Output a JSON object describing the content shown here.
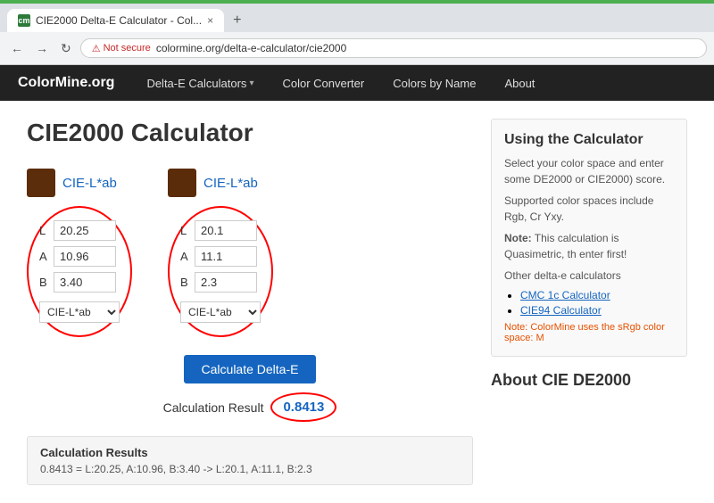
{
  "browser": {
    "tab_favicon": "cm",
    "tab_title": "CIE2000 Delta-E Calculator - Col...",
    "tab_close": "×",
    "new_tab": "+",
    "nav_back": "←",
    "nav_forward": "→",
    "nav_refresh": "↻",
    "not_secure_label": "Not secure",
    "url": "colormine.org/delta-e-calculator/cie2000"
  },
  "nav": {
    "logo": "ColorMine.org",
    "items": [
      {
        "label": "Delta-E Calculators",
        "has_dropdown": true
      },
      {
        "label": "Color Converter",
        "has_dropdown": false
      },
      {
        "label": "Colors by Name",
        "has_dropdown": false
      },
      {
        "label": "About",
        "has_dropdown": false
      }
    ]
  },
  "page": {
    "title": "CIE2000 Calculator"
  },
  "color1": {
    "swatch_color": "#5c2d0a",
    "space_label": "CIE-L*ab",
    "L_value": "20.25",
    "A_value": "10.96",
    "B_value": "3.40",
    "select_value": "CIE-L*ab"
  },
  "color2": {
    "swatch_color": "#5a2c0a",
    "space_label": "CIE-L*ab",
    "L_value": "20.1",
    "A_value": "11.1",
    "B_value": "2.3",
    "select_value": "CIE-L*ab"
  },
  "calculator": {
    "button_label": "Calculate Delta-E",
    "result_label": "Calculation Result",
    "result_value": "0.8413"
  },
  "calc_results_box": {
    "title": "Calculation Results",
    "text": "0.8413 = L:20.25, A:10.96, B:3.40 -> L:20.1, A:11.1, B:2.3"
  },
  "sidebar": {
    "using_title": "Using the Calculator",
    "using_text1": "Select your color space and enter some DE2000 or CIE2000) score.",
    "using_text2": "Supported color spaces include Rgb, Cr Yxy.",
    "note_label": "Note:",
    "note_text": "This calculation is Quasimetric, th enter first!",
    "other_calcs_label": "Other delta-e calculators",
    "calc_links": [
      {
        "label": "CMC 1c Calculator"
      },
      {
        "label": "CIE94 Calculator"
      }
    ],
    "note2": "Note: ColorMine uses the sRgb color space: M",
    "about_title": "About CIE DE2000"
  }
}
